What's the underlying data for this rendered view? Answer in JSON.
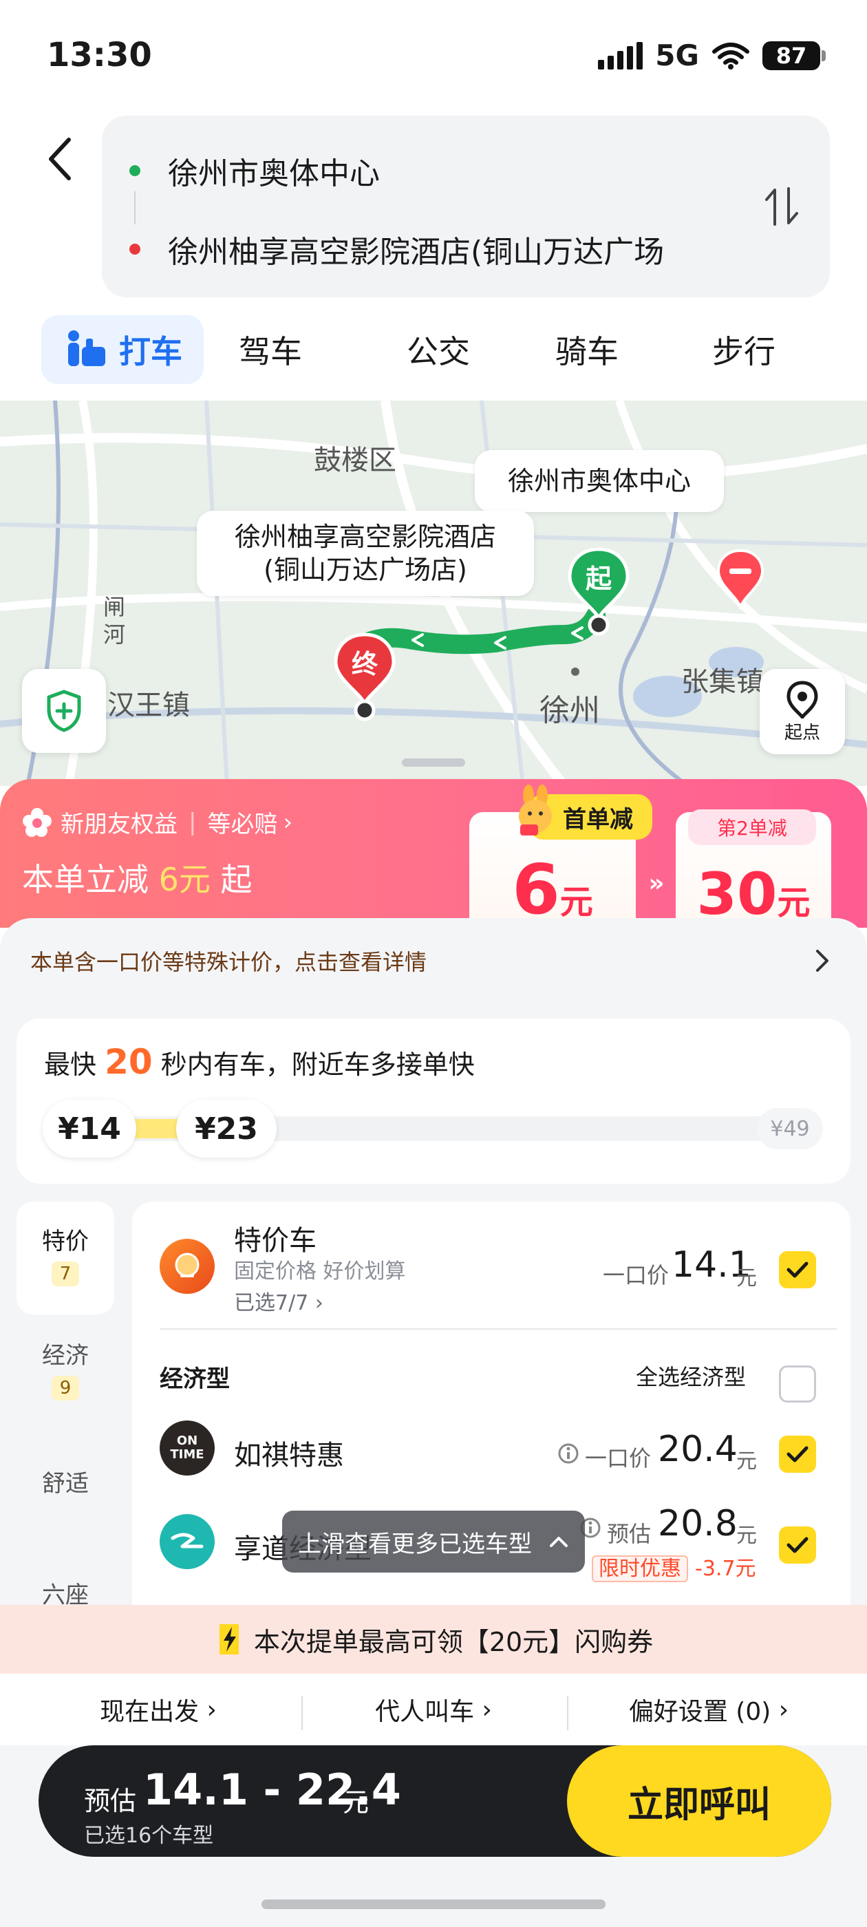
{
  "status_bar": {
    "time": "13:30",
    "network": "5G",
    "battery": "87"
  },
  "route": {
    "start": "徐州市奥体中心",
    "end": "徐州柚享高空影院酒店(铜山万达广场"
  },
  "tabs": [
    {
      "label": "打车"
    },
    {
      "label": "驾车"
    },
    {
      "label": "公交"
    },
    {
      "label": "骑车"
    },
    {
      "label": "步行"
    }
  ],
  "map": {
    "labels": {
      "gulou": "鼓楼区",
      "hanwang": "汉王镇",
      "xuzhou": "徐州",
      "zhangji": "张集镇",
      "river": "闸河"
    },
    "bubble_start": "徐州市奥体中心",
    "bubble_end_line1": "徐州柚享高空影院酒店",
    "bubble_end_line2": "(铜山万达广场店)",
    "marker_start": "起",
    "marker_end": "终",
    "origin_button": "起点"
  },
  "promo": {
    "tag": "新朋友权益",
    "link": "等必赔",
    "main_prefix": "本单立减",
    "main_amount": "6元",
    "main_suffix": "起",
    "coupon1_tag": "首单减",
    "coupon1_value": "6",
    "coupon1_unit": "元",
    "coupon2_tag": "第2单减",
    "coupon2_value": "30",
    "coupon2_unit": "元"
  },
  "notice": "本单含一口价等特殊计价，点击查看详情",
  "fast": {
    "prefix": "最快",
    "seconds": "20",
    "suffix": "秒内有车，附近车多接单快",
    "price_low": "¥14",
    "price_mid": "¥23",
    "price_max": "¥49"
  },
  "categories": [
    {
      "label": "特价",
      "count": "7"
    },
    {
      "label": "经济",
      "count": "9"
    },
    {
      "label": "舒适"
    },
    {
      "label": "六座"
    }
  ],
  "cars": {
    "tejia": {
      "name": "特价车",
      "desc": "固定价格  好价划算",
      "selected": "已选7/7",
      "price_label": "一口价",
      "price": "14.1",
      "unit": "元"
    },
    "economy_title": "经济型",
    "economy_select_all": "全选经济型",
    "ontime": {
      "name": "如祺特惠",
      "logo_line1": "ON",
      "logo_line2": "TIME",
      "price_label": "一口价",
      "price": "20.4",
      "unit": "元"
    },
    "xiangdao": {
      "name": "享道经济型",
      "price_label": "预估",
      "price": "20.8",
      "unit": "元",
      "promo_label": "限时优惠",
      "promo_value": "-3.7元"
    }
  },
  "swipe_hint": "上滑查看更多已选车型",
  "voucher": "本次提单最高可领【20元】闪购券",
  "options": {
    "depart": "现在出发",
    "proxy": "代人叫车",
    "pref": "偏好设置 (0)"
  },
  "bottom": {
    "est_label": "预估",
    "est_value": "14.1 - 22.4",
    "est_unit": "元",
    "selected": "已选16个车型",
    "call": "立即呼叫"
  },
  "colors": {
    "accent_blue": "#1f6ff0",
    "call_yellow": "#ffd91f",
    "route_green": "#1fad5b",
    "end_red": "#e8383d",
    "promo_pink": "#ff6f8d"
  }
}
